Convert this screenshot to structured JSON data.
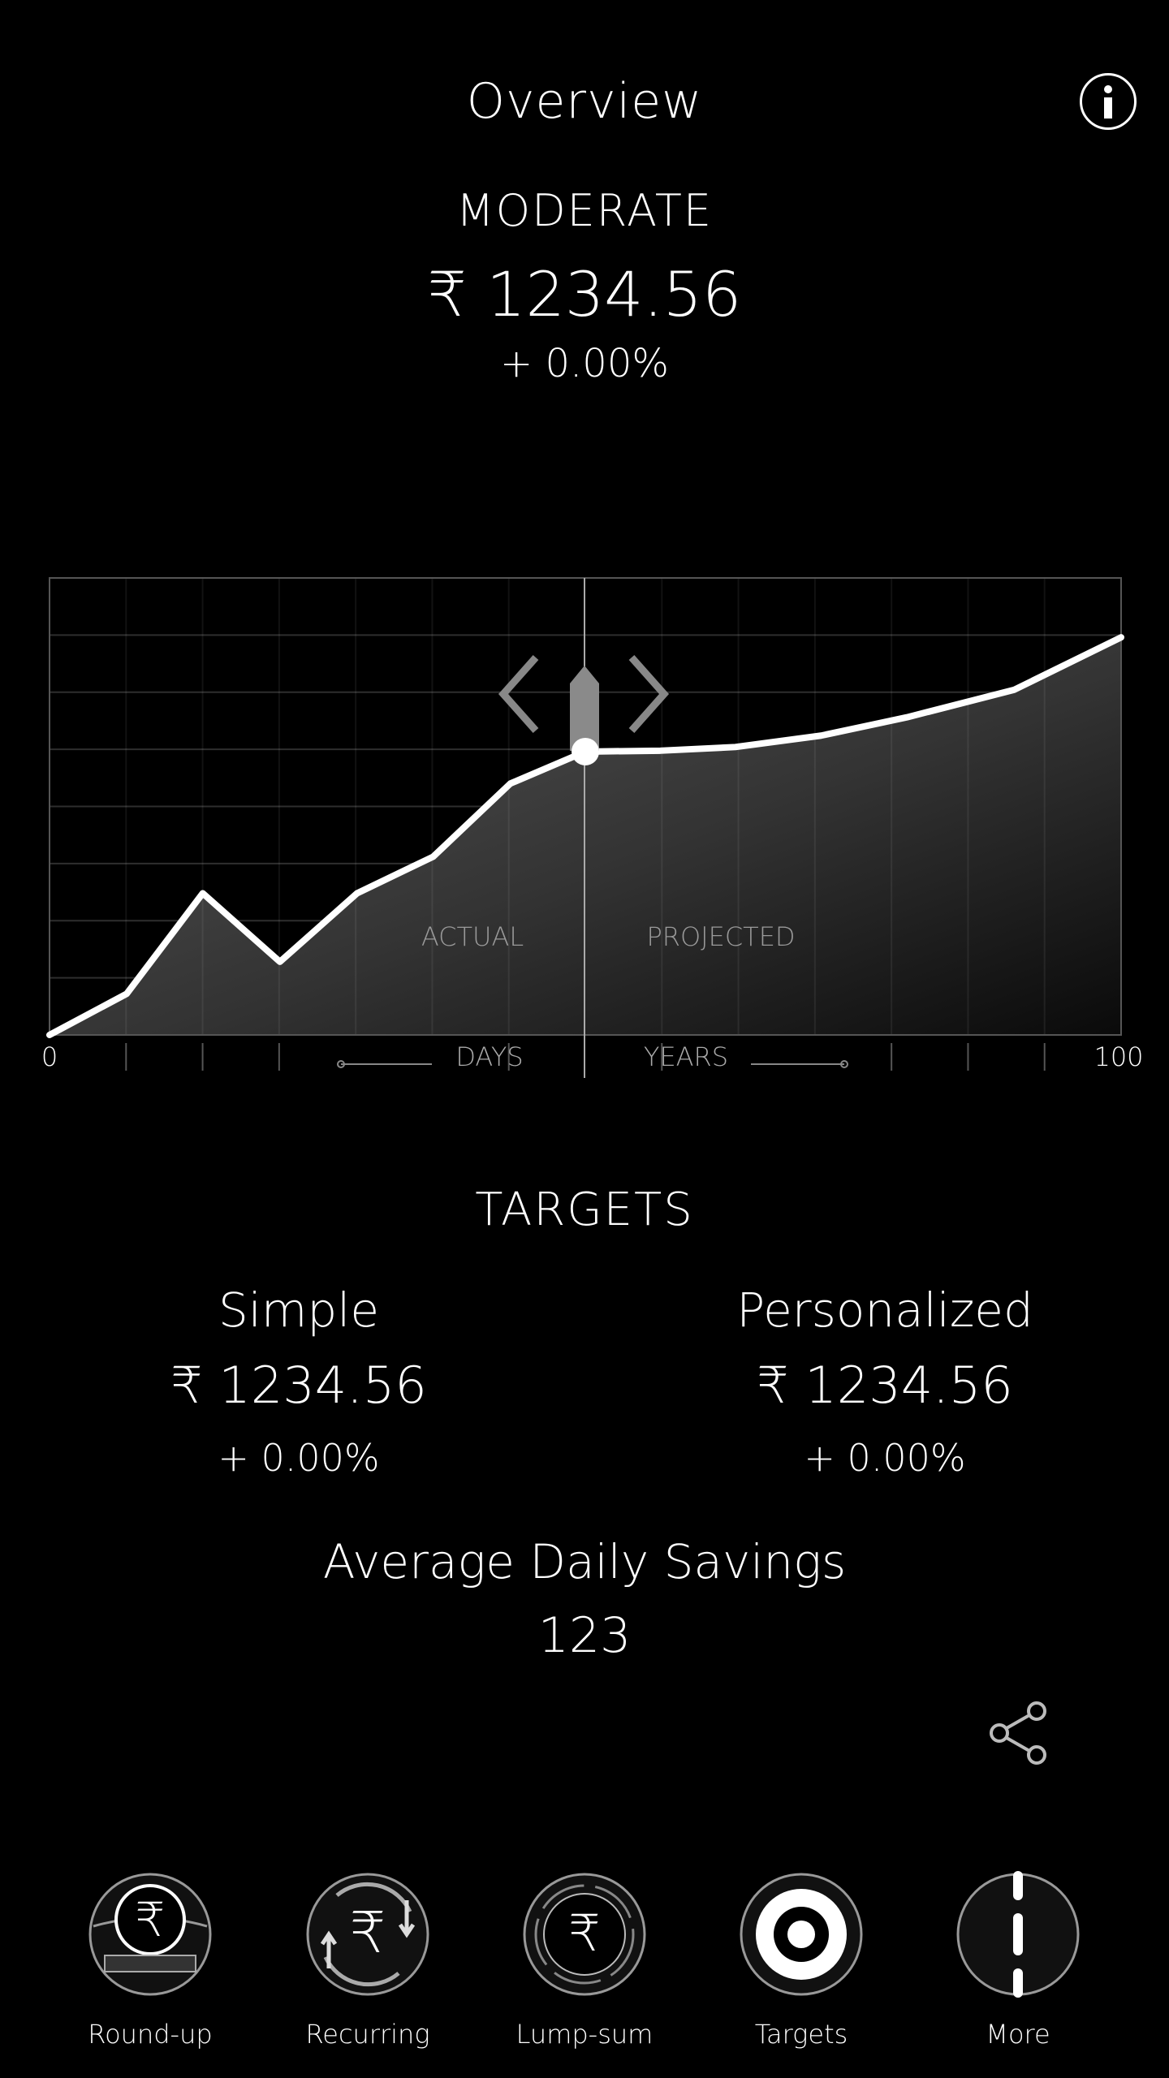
{
  "header": {
    "title": "Overview"
  },
  "summary": {
    "risk_level": "MODERATE",
    "amount": "₹ 1234.56",
    "change": "+ 0.00%"
  },
  "chart_data": {
    "type": "area",
    "series": [
      {
        "values": [
          {
            "x": 0,
            "y": 0
          },
          {
            "x": 7.2,
            "y": 9
          },
          {
            "x": 14.3,
            "y": 31
          },
          {
            "x": 21.5,
            "y": 16
          },
          {
            "x": 28.7,
            "y": 31
          },
          {
            "x": 35.8,
            "y": 39
          },
          {
            "x": 43,
            "y": 55
          },
          {
            "x": 50,
            "y": 62
          },
          {
            "x": 57,
            "y": 62.2
          },
          {
            "x": 64,
            "y": 63
          },
          {
            "x": 72,
            "y": 65.5
          },
          {
            "x": 80,
            "y": 69.5
          },
          {
            "x": 90,
            "y": 75.5
          },
          {
            "x": 100,
            "y": 87
          }
        ]
      }
    ],
    "divider_x": 50,
    "region_labels": {
      "left": "ACTUAL",
      "right": "PROJECTED"
    },
    "x_tick_labels": {
      "start": "0",
      "end": "100"
    },
    "x_axis_labels": {
      "left": "DAYS",
      "right": "YEARS"
    },
    "xlim": [
      0,
      100
    ],
    "ylim": [
      0,
      100
    ],
    "grid": true
  },
  "targets": {
    "heading": "TARGETS",
    "simple": {
      "name": "Simple",
      "amount": "₹ 1234.56",
      "change": "+ 0.00%"
    },
    "personalized": {
      "name": "Personalized",
      "amount": "₹ 1234.56",
      "change": "+ 0.00%"
    }
  },
  "savings": {
    "label": "Average Daily Savings",
    "value": "123"
  },
  "nav": {
    "items": [
      {
        "label": "Round-up",
        "icon": "round-up-icon"
      },
      {
        "label": "Recurring",
        "icon": "recurring-icon"
      },
      {
        "label": "Lump-sum",
        "icon": "lump-sum-icon"
      },
      {
        "label": "Targets",
        "icon": "targets-icon"
      },
      {
        "label": "More",
        "icon": "more-icon"
      }
    ]
  },
  "colors": {
    "background": "#000000",
    "foreground": "#ffffff",
    "muted": "#9a9a9a"
  }
}
